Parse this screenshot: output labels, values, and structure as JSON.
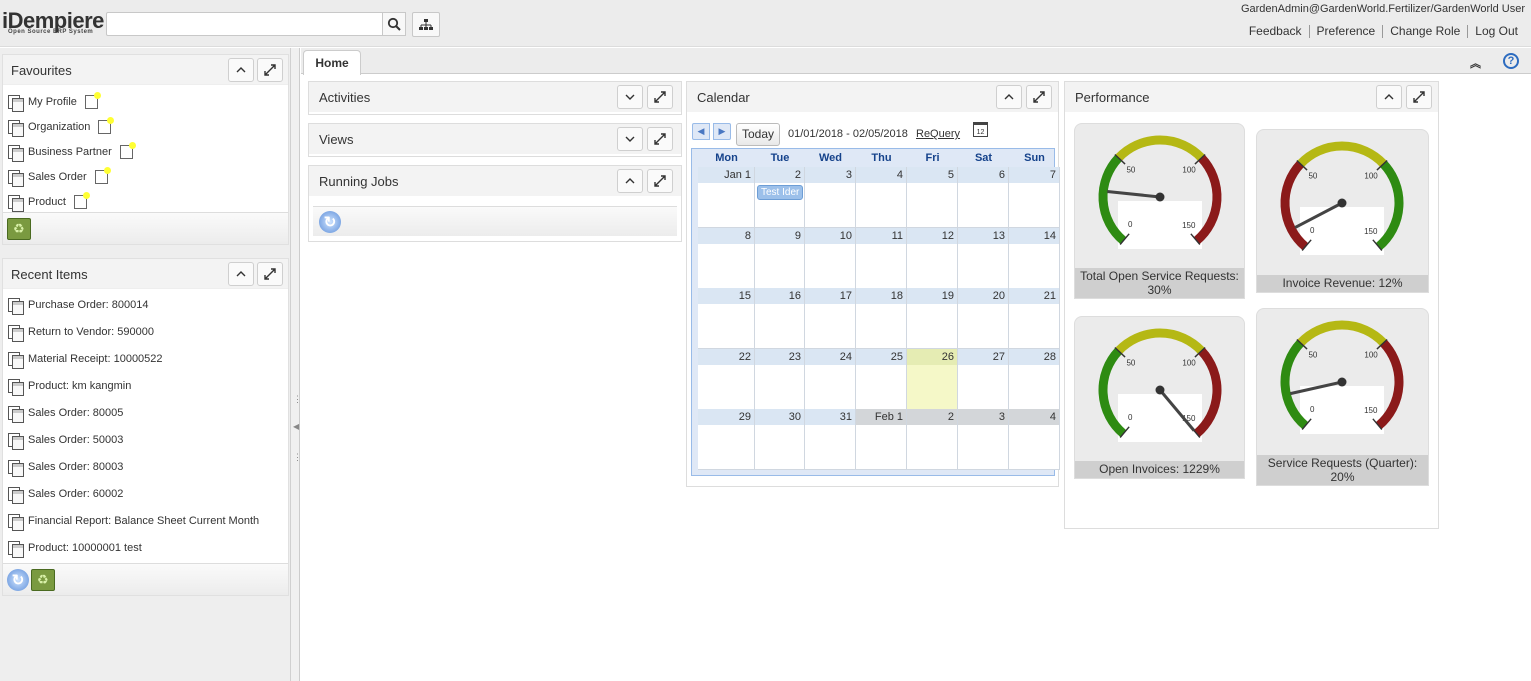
{
  "app": {
    "logo": "iDempiere",
    "logo_sub": "Open Source ERP System",
    "user": "GardenAdmin@GardenWorld.Fertilizer/GardenWorld User",
    "links": [
      "Feedback",
      "Preference",
      "Change Role",
      "Log Out"
    ]
  },
  "favourites": {
    "title": "Favourites",
    "items": [
      "My Profile",
      "Organization",
      "Business Partner",
      "Sales Order",
      "Product"
    ]
  },
  "recent": {
    "title": "Recent Items",
    "items": [
      "Purchase Order: 800014",
      "Return to Vendor: 590000",
      "Material Receipt: 10000522",
      "Product: km kangmin",
      "Sales Order: 80005",
      "Sales Order: 50003",
      "Sales Order: 80003",
      "Sales Order: 60002",
      "Financial Report: Balance Sheet Current Month",
      "Product: 10000001 test"
    ]
  },
  "tabs": {
    "home": "Home"
  },
  "dashboard": {
    "activities": "Activities",
    "views": "Views",
    "running_jobs": "Running Jobs",
    "calendar": "Calendar",
    "performance": "Performance"
  },
  "calendar": {
    "today_btn": "Today",
    "range": "01/01/2018 - 02/05/2018",
    "requery": "ReQuery",
    "dows": [
      "Mon",
      "Tue",
      "Wed",
      "Thu",
      "Fri",
      "Sat",
      "Sun"
    ],
    "weeks": [
      [
        "Jan 1",
        "2",
        "3",
        "4",
        "5",
        "6",
        "7"
      ],
      [
        "8",
        "9",
        "10",
        "11",
        "12",
        "13",
        "14"
      ],
      [
        "15",
        "16",
        "17",
        "18",
        "19",
        "20",
        "21"
      ],
      [
        "22",
        "23",
        "24",
        "25",
        "26",
        "27",
        "28"
      ],
      [
        "29",
        "30",
        "31",
        "Feb 1",
        "2",
        "3",
        "4"
      ]
    ],
    "today_index": [
      3,
      4
    ],
    "other_month_from": [
      4,
      3
    ],
    "event": {
      "week": 0,
      "day": 1,
      "label": "Test Ider"
    }
  },
  "gauges": [
    {
      "caption": "Total Open Service Requests: 30%",
      "needle_value": 30,
      "color_order": "green-yellow-red",
      "ticks": [
        "0",
        "50",
        "100",
        "150"
      ]
    },
    {
      "caption": "Invoice Revenue: 12%",
      "needle_value": 12,
      "color_order": "red-yellow-green",
      "ticks": [
        "0",
        "50",
        "100",
        "150"
      ]
    },
    {
      "caption": "Open Invoices: 1229%",
      "needle_value": 1229,
      "color_order": "green-yellow-red",
      "ticks": [
        "0",
        "50",
        "100",
        "150"
      ]
    },
    {
      "caption": "Service Requests (Quarter): 20%",
      "needle_value": 20,
      "color_order": "green-yellow-red",
      "ticks": [
        "0",
        "50",
        "100",
        "150"
      ]
    }
  ],
  "colors": {
    "green": "#2e8b12",
    "yellow": "#b5b814",
    "red": "#8b1a1a",
    "cal_header": "#15428b"
  }
}
